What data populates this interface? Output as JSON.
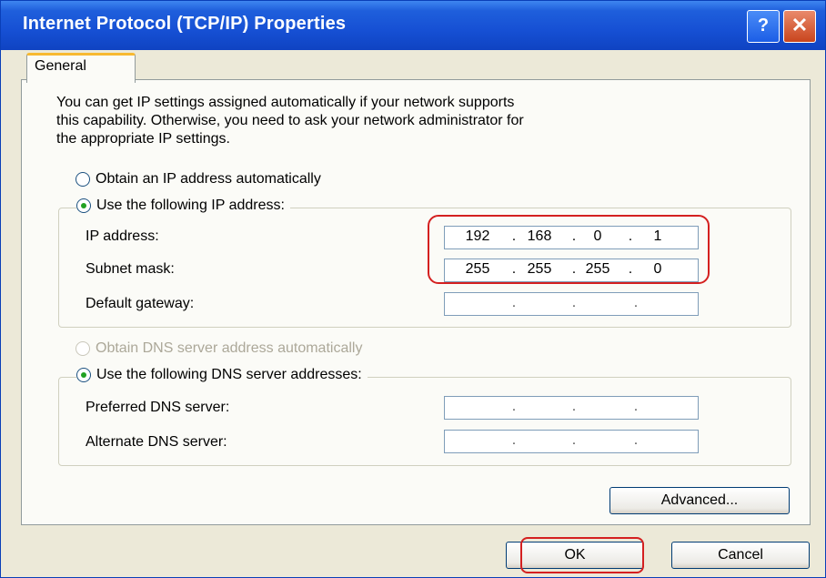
{
  "window": {
    "title": "Internet Protocol (TCP/IP) Properties",
    "help_glyph": "?",
    "close_glyph": "✕"
  },
  "tabs": [
    {
      "label": "General"
    }
  ],
  "intro_text": "You can get IP settings assigned automatically if your network supports\nthis capability. Otherwise, you need to ask your network administrator for\nthe appropriate IP settings.",
  "ip_section": {
    "auto_label": "Obtain an IP address automatically",
    "manual_label": "Use the following IP address:",
    "selected": "manual",
    "fields": [
      {
        "label": "IP address:",
        "octets": [
          "192",
          "168",
          "0",
          "1"
        ]
      },
      {
        "label": "Subnet mask:",
        "octets": [
          "255",
          "255",
          "255",
          "0"
        ]
      },
      {
        "label": "Default gateway:",
        "octets": [
          "",
          "",
          "",
          ""
        ]
      }
    ]
  },
  "dns_section": {
    "auto_label": "Obtain DNS server address automatically",
    "manual_label": "Use the following DNS server addresses:",
    "selected": "manual",
    "auto_disabled": true,
    "fields": [
      {
        "label": "Preferred DNS server:",
        "octets": [
          "",
          "",
          "",
          ""
        ]
      },
      {
        "label": "Alternate DNS server:",
        "octets": [
          "",
          "",
          "",
          ""
        ]
      }
    ]
  },
  "buttons": {
    "advanced": "Advanced...",
    "ok": "OK",
    "cancel": "Cancel"
  },
  "colors": {
    "titlebar": "#1650d4",
    "highlight": "#d42020",
    "radio_dot": "#21a121"
  }
}
